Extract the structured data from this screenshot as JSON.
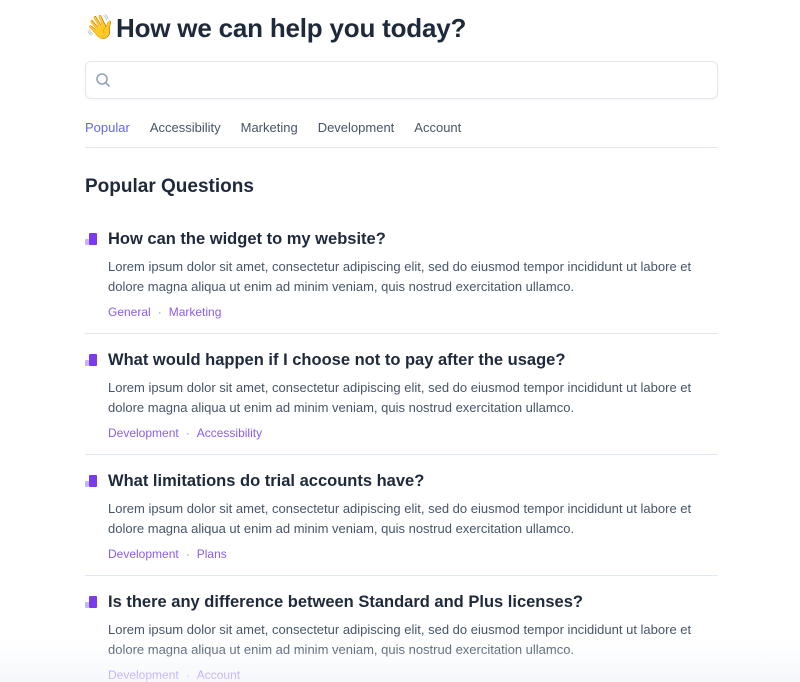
{
  "header": {
    "emoji": "👋",
    "title": "How we can help you today?"
  },
  "search": {
    "value": "",
    "placeholder": ""
  },
  "tabs": [
    {
      "label": "Popular",
      "active": true
    },
    {
      "label": "Accessibility",
      "active": false
    },
    {
      "label": "Marketing",
      "active": false
    },
    {
      "label": "Development",
      "active": false
    },
    {
      "label": "Account",
      "active": false
    }
  ],
  "section": {
    "title": "Popular Questions"
  },
  "questions": [
    {
      "question": "How can the widget to my website?",
      "answer": "Lorem ipsum dolor sit amet, consectetur adipiscing elit, sed do eiusmod tempor incididunt ut labore et dolore magna aliqua ut enim ad minim veniam, quis nostrud exercitation ullamco.",
      "tags": [
        "General",
        "Marketing"
      ]
    },
    {
      "question": "What would happen if I choose not to pay after the usage?",
      "answer": "Lorem ipsum dolor sit amet, consectetur adipiscing elit, sed do eiusmod tempor incididunt ut labore et dolore magna aliqua ut enim ad minim veniam, quis nostrud exercitation ullamco.",
      "tags": [
        "Development",
        "Accessibility"
      ]
    },
    {
      "question": "What limitations do trial accounts have?",
      "answer": "Lorem ipsum dolor sit amet, consectetur adipiscing elit, sed do eiusmod tempor incididunt ut labore et dolore magna aliqua ut enim ad minim veniam, quis nostrud exercitation ullamco.",
      "tags": [
        "Development",
        "Plans"
      ]
    },
    {
      "question": "Is there any difference between Standard and Plus licenses?",
      "answer": "Lorem ipsum dolor sit amet, consectetur adipiscing elit, sed do eiusmod tempor incididunt ut labore et dolore magna aliqua ut enim ad minim veniam, quis nostrud exercitation ullamco.",
      "tags": [
        "Development",
        "Account"
      ]
    }
  ],
  "icons": {
    "search": "search-icon",
    "question": "bar-chart-icon"
  },
  "colors": {
    "accent": "#6366f1",
    "tag": "#8b5cf6",
    "text": "#1e293b",
    "muted": "#475569",
    "border": "#e2e8f0"
  }
}
